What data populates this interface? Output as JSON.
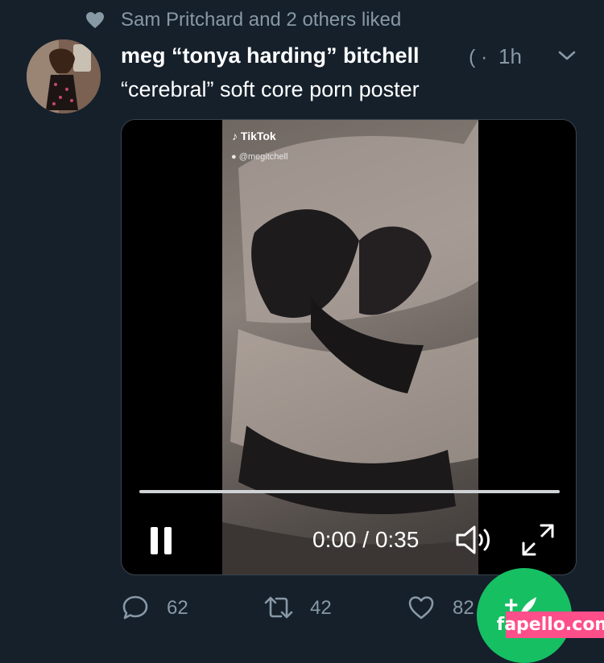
{
  "social_context": {
    "icon": "heart-icon",
    "text": "Sam Pritchard and 2 others liked"
  },
  "tweet": {
    "author_name": "meg “tonya harding” bitchell",
    "handle_truncated": "(",
    "separator": "·",
    "time": "1h",
    "text": "“cerebral” soft core porn poster"
  },
  "media": {
    "watermark_brand": "TikTok",
    "watermark_user": "@megitchell",
    "time_readout": "0:00 / 0:35",
    "progress": 0.0,
    "controls": {
      "pause": "pause-icon",
      "volume": "volume-icon",
      "fullscreen": "fullscreen-icon"
    }
  },
  "actions": {
    "reply_count": "62",
    "retweet_count": "42",
    "like_count": "82"
  },
  "colors": {
    "background": "#15202b",
    "muted_text": "#8899a6",
    "compose_green": "#17bf63",
    "watermark_pink": "#ff4f8a"
  },
  "site_watermark": "fapello.com"
}
